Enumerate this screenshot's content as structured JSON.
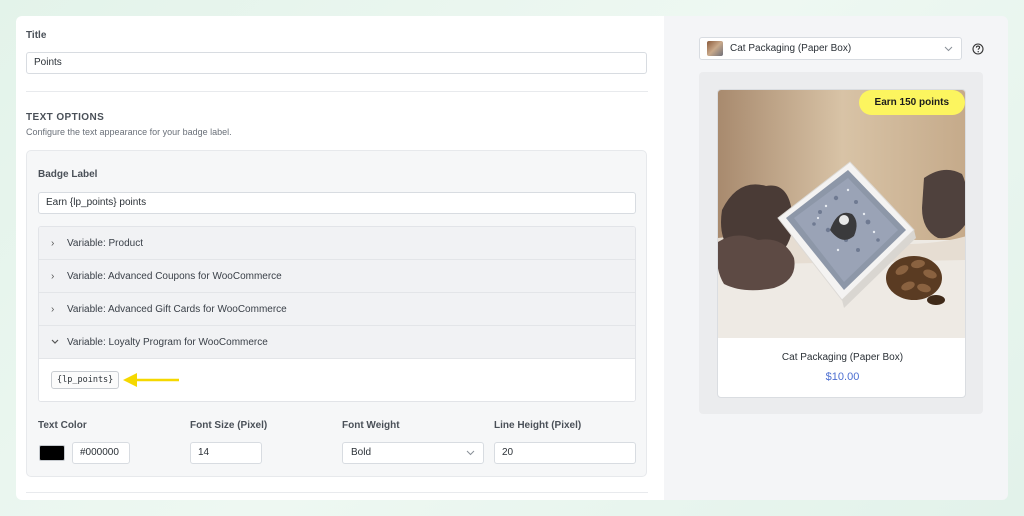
{
  "title_section": {
    "label": "Title",
    "value": "Points"
  },
  "text_options": {
    "heading": "TEXT OPTIONS",
    "description": "Configure the text appearance for your badge label.",
    "badge_label": {
      "label": "Badge Label",
      "value": "Earn {lp_points} points"
    },
    "variables": [
      {
        "label": "Variable: Product",
        "expanded": false
      },
      {
        "label": "Variable: Advanced Coupons for WooCommerce",
        "expanded": false
      },
      {
        "label": "Variable: Advanced Gift Cards for WooCommerce",
        "expanded": false
      },
      {
        "label": "Variable: Loyalty Program for WooCommerce",
        "expanded": true
      }
    ],
    "expanded_variable_tag": "{lp_points}",
    "text_color": {
      "label": "Text Color",
      "value": "#000000",
      "swatch": "#000000"
    },
    "font_size": {
      "label": "Font Size (Pixel)",
      "value": "14"
    },
    "font_weight": {
      "label": "Font Weight",
      "value": "Bold"
    },
    "line_height": {
      "label": "Line Height (Pixel)",
      "value": "20"
    }
  },
  "preview": {
    "product_select": {
      "value": "Cat Packaging (Paper Box)",
      "icon": "chevron-down-icon"
    },
    "help_icon": "question-circle-icon",
    "card": {
      "badge": "Earn 150 points",
      "badge_color": "#fcf55f",
      "title": "Cat Packaging (Paper Box)",
      "price": "$10.00",
      "price_color": "#4d6fd1"
    }
  },
  "colors": {
    "accent_arrow": "#f5d800",
    "panel_bg": "#ffffff",
    "page_bg": "#e6f4ec"
  }
}
